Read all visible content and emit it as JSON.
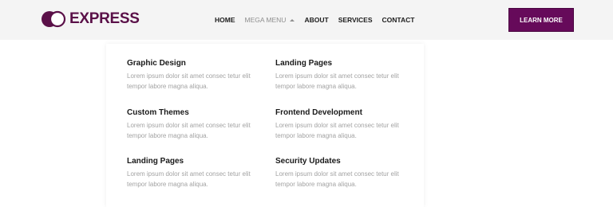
{
  "brand": {
    "name": "EXPRESS",
    "color": "#5a1048"
  },
  "nav": {
    "items": [
      {
        "label": "HOME"
      },
      {
        "label": "MEGA MENU"
      },
      {
        "label": "ABOUT"
      },
      {
        "label": "SERVICES"
      },
      {
        "label": "CONTACT"
      }
    ]
  },
  "cta": {
    "label": "LEARN MORE",
    "color": "#660a5a"
  },
  "mega_menu": {
    "items": [
      {
        "title": "Graphic Design",
        "desc_line1": "Lorem ipsum dolor sit amet consec tetur elit",
        "desc_line2": "tempor labore magna aliqua."
      },
      {
        "title": "Landing Pages",
        "desc_line1": "Lorem ipsum dolor sit amet consec tetur elit",
        "desc_line2": "tempor labore magna aliqua."
      },
      {
        "title": "Custom Themes",
        "desc_line1": "Lorem ipsum dolor sit amet consec tetur elit",
        "desc_line2": "tempor labore magna aliqua."
      },
      {
        "title": "Frontend Development",
        "desc_line1": "Lorem ipsum dolor sit amet consec tetur elit",
        "desc_line2": "tempor labore magna aliqua."
      },
      {
        "title": "Landing Pages",
        "desc_line1": "Lorem ipsum dolor sit amet consec tetur elit",
        "desc_line2": "tempor labore magna aliqua."
      },
      {
        "title": "Security Updates",
        "desc_line1": "Lorem ipsum dolor sit amet consec tetur elit",
        "desc_line2": "tempor labore magna aliqua."
      }
    ]
  }
}
